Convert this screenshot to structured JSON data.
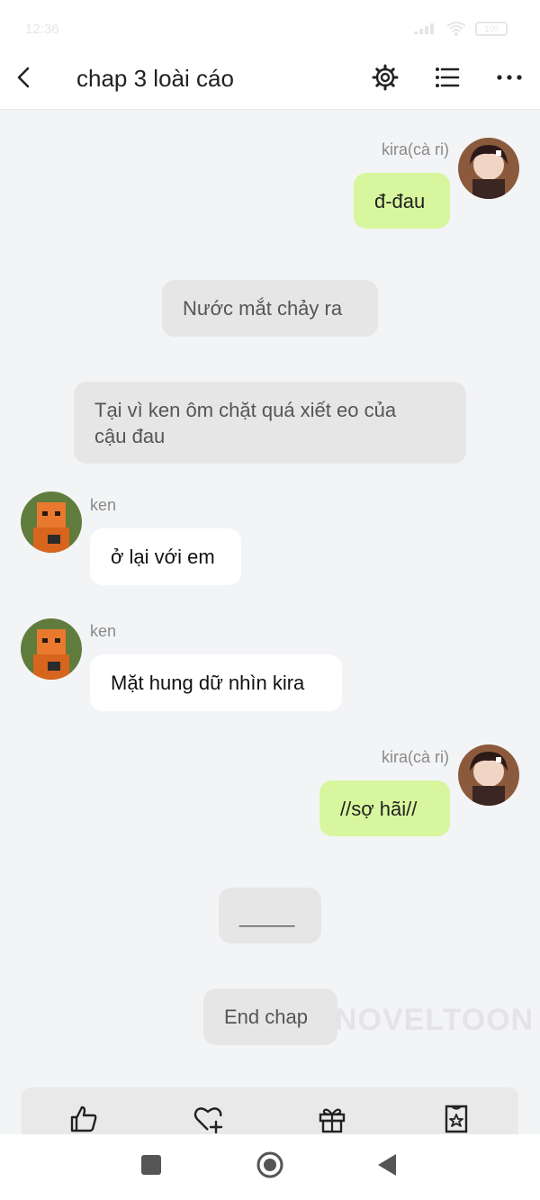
{
  "status_bar": {
    "time": "12:36",
    "battery": "100"
  },
  "header": {
    "title": "chap 3 loài cáo"
  },
  "messages": [
    {
      "speaker": "kira(cà ri)",
      "text": "đ-đau"
    },
    {
      "narration": "Nước mắt chảy ra"
    },
    {
      "narration_line1": "Tại vì ken ôm chặt quá xiết eo của",
      "narration_line2": "cậu đau"
    },
    {
      "speaker": "ken",
      "text": "ở lại với em"
    },
    {
      "speaker": "ken",
      "text": "Mặt hung dữ nhìn kira"
    },
    {
      "speaker": "kira(cà ri)",
      "text": "//sợ hãi//"
    },
    {
      "narration": "_____"
    },
    {
      "narration": "End chap"
    }
  ],
  "watermark": "NOVELTOON",
  "actions": {
    "like_icon": "thumbs-up-icon",
    "follow_icon": "heart-plus-icon",
    "gift_icon": "gift-icon",
    "vote_icon": "ticket-star-icon"
  },
  "colors": {
    "right_bubble": "#d8f69d",
    "left_bubble": "#ffffff",
    "narration_bubble": "#e6e6e6",
    "background": "#f3f4f6"
  }
}
